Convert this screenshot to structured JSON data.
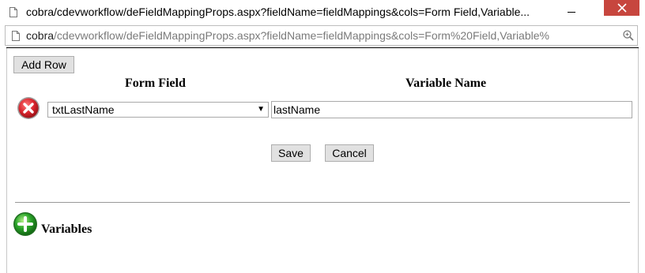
{
  "window": {
    "title": "cobra/cdevworkflow/deFieldMappingProps.aspx?fieldName=fieldMappings&cols=Form Field,Variable..."
  },
  "address": {
    "host": "cobra",
    "path": "/cdevworkflow/deFieldMappingProps.aspx?fieldName=fieldMappings&cols=Form%20Field,Variable%"
  },
  "toolbar": {
    "add_row_label": "Add Row"
  },
  "table": {
    "headers": [
      "Form Field",
      "Variable Name"
    ],
    "rows": [
      {
        "form_field": "txtLastName",
        "variable_name": "lastName"
      }
    ]
  },
  "actions": {
    "save_label": "Save",
    "cancel_label": "Cancel"
  },
  "variables": {
    "heading": "Variables"
  },
  "colors": {
    "close_button": "#c7463e",
    "add_icon": "#2aa52a",
    "delete_icon": "#d9262e"
  },
  "icons": {
    "page": "page-icon",
    "zoom": "zoom-icon",
    "delete": "delete-row-icon",
    "add": "add-variable-icon"
  }
}
